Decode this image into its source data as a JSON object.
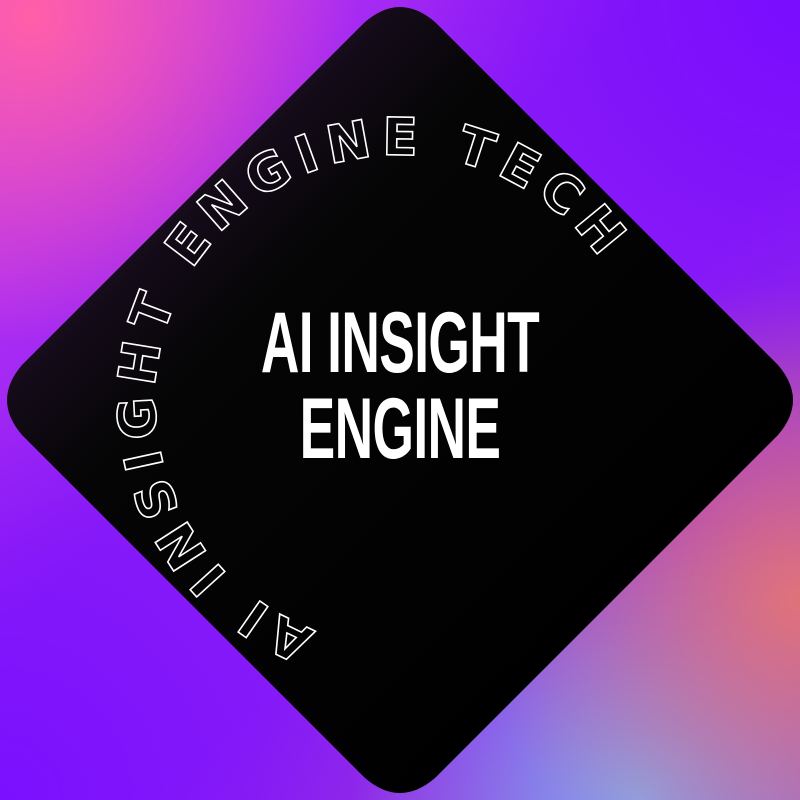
{
  "badge": {
    "ring_text": "AI INSIGHT ENGINE TECH",
    "title_line1": "AI INSIGHT",
    "title_line2": "ENGINE"
  },
  "colors": {
    "badge_fill": "#000000",
    "text": "#ffffff",
    "bg_pink": "#ff5fa8",
    "bg_purple": "#7a0cff",
    "bg_coral": "#e0737a",
    "bg_blue": "#7fa8f2"
  }
}
